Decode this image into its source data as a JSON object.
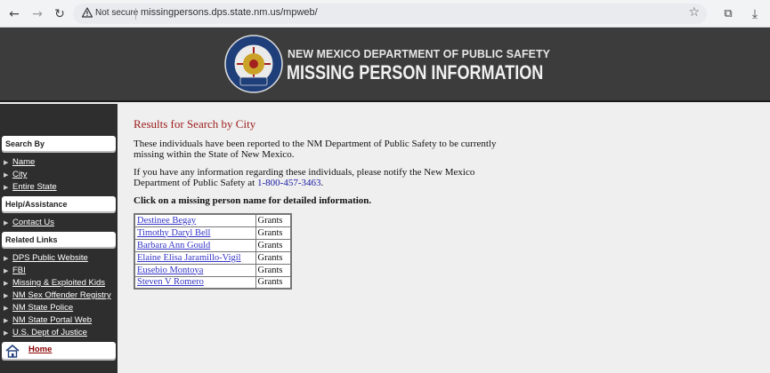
{
  "browser": {
    "not_secure": "Not secure",
    "url": "missingpersons.dps.state.nm.us/mpweb/"
  },
  "banner": {
    "line1": "NEW MEXICO DEPARTMENT OF PUBLIC SAFETY",
    "line2": "MISSING PERSON INFORMATION"
  },
  "sidebar": {
    "search_by": "Search By",
    "search_items": [
      "Name",
      "City",
      "Entire State"
    ],
    "help": "Help/Assistance",
    "help_items": [
      "Contact Us"
    ],
    "related": "Related Links",
    "related_items": [
      "DPS Public Website",
      "FBI",
      "Missing & Exploited Kids",
      "NM Sex Offender Registry",
      "NM State Police",
      "NM State Portal Web",
      "U.S. Dept of Justice"
    ],
    "home": "Home"
  },
  "main": {
    "title": "Results for Search by City",
    "para1": "These individuals have been reported to the NM Department of Public Safety to be currently missing within the State of New Mexico.",
    "para2_prefix": "If you have any information regarding these individuals, please notify the New Mexico Department of Public Safety at ",
    "phone": "1-800-457-3463",
    "para2_suffix": ".",
    "instruction": "Click on a missing person name for detailed information."
  },
  "results": [
    {
      "name": "Destinee Begay",
      "city": "Grants"
    },
    {
      "name": "Timothy Daryl Bell",
      "city": "Grants"
    },
    {
      "name": "Barbara Ann Gould",
      "city": "Grants"
    },
    {
      "name": "Elaine Elisa Jaramillo-Vigil",
      "city": "Grants"
    },
    {
      "name": "Eusebio Montoya",
      "city": "Grants"
    },
    {
      "name": "Steven V Romero",
      "city": "Grants"
    }
  ]
}
